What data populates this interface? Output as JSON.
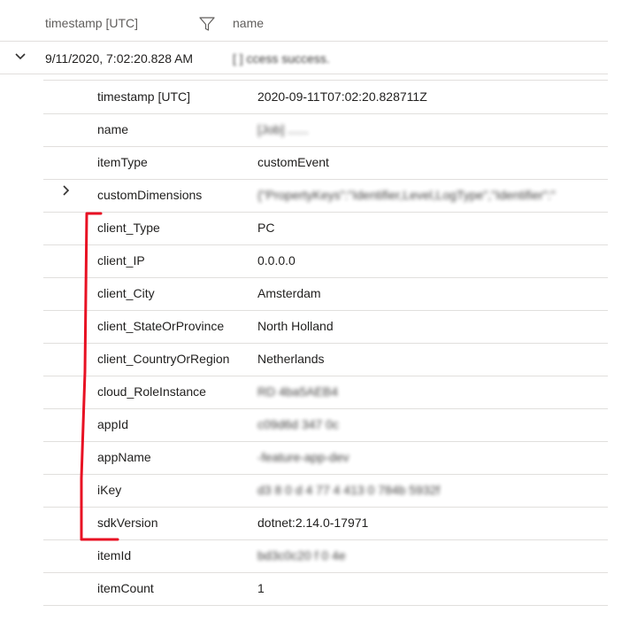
{
  "header": {
    "timestamp_col": "timestamp [UTC]",
    "name_col": "name",
    "filter_icon": "filter-icon"
  },
  "record": {
    "timestamp": "9/11/2020, 7:02:20.828 AM",
    "name": "[ ]   ccess success.",
    "expand_icon": "chevron-down-icon"
  },
  "details": [
    {
      "key": "timestamp [UTC]",
      "value": "2020-09-11T07:02:20.828711Z",
      "redacted": false
    },
    {
      "key": "name",
      "value": "[Job]    ......",
      "redacted": true
    },
    {
      "key": "itemType",
      "value": "customEvent",
      "redacted": false
    },
    {
      "key": "customDimensions",
      "value": "{\"PropertyKeys\":\"Identifier,Level,LogType\",\"Identifier\":\"",
      "redacted": true,
      "expandable": true
    },
    {
      "key": "client_Type",
      "value": "PC",
      "redacted": false
    },
    {
      "key": "client_IP",
      "value": "0.0.0.0",
      "redacted": false
    },
    {
      "key": "client_City",
      "value": "Amsterdam",
      "redacted": false
    },
    {
      "key": "client_StateOrProvince",
      "value": "North Holland",
      "redacted": false
    },
    {
      "key": "client_CountryOrRegion",
      "value": "Netherlands",
      "redacted": false
    },
    {
      "key": "cloud_RoleInstance",
      "value": "RD       4ba5AEB4",
      "redacted": true
    },
    {
      "key": "appId",
      "value": "c09d6d 347  0c",
      "redacted": true
    },
    {
      "key": "appName",
      "value": "     -feature-app-dev",
      "redacted": true
    },
    {
      "key": "iKey",
      "value": "      d3  8 0 d 4 77 4 413 0 784b 5932f",
      "redacted": true
    },
    {
      "key": "sdkVersion",
      "value": "dotnet:2.14.0-17971",
      "redacted": false
    },
    {
      "key": "itemId",
      "value": "bd3c0c20  f        0  4e",
      "redacted": true
    },
    {
      "key": "itemCount",
      "value": "1",
      "redacted": false
    }
  ],
  "colors": {
    "annotation": "#e81123",
    "divider": "#e1dfdd",
    "text": "#201f1e"
  }
}
